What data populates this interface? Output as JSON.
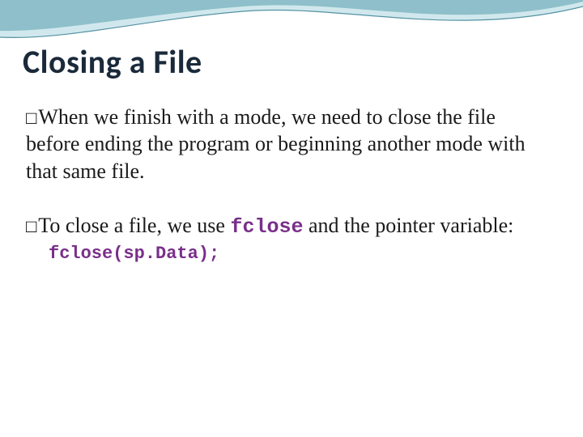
{
  "title": "Closing a File",
  "bullets": [
    {
      "marker": "□",
      "text": "When we finish with a mode, we need to close the file before ending the program or beginning another mode with that same file."
    },
    {
      "marker": "□",
      "prefix": "To close a file, we use ",
      "code_inline": "fclose",
      "suffix": " and the pointer variable:",
      "code_line": "fclose(sp.Data);"
    }
  ],
  "colors": {
    "title": "#1b2a3a",
    "code": "#7a2f8a",
    "band_dark": "#2f7a8e",
    "band_light": "#a9d6de"
  }
}
